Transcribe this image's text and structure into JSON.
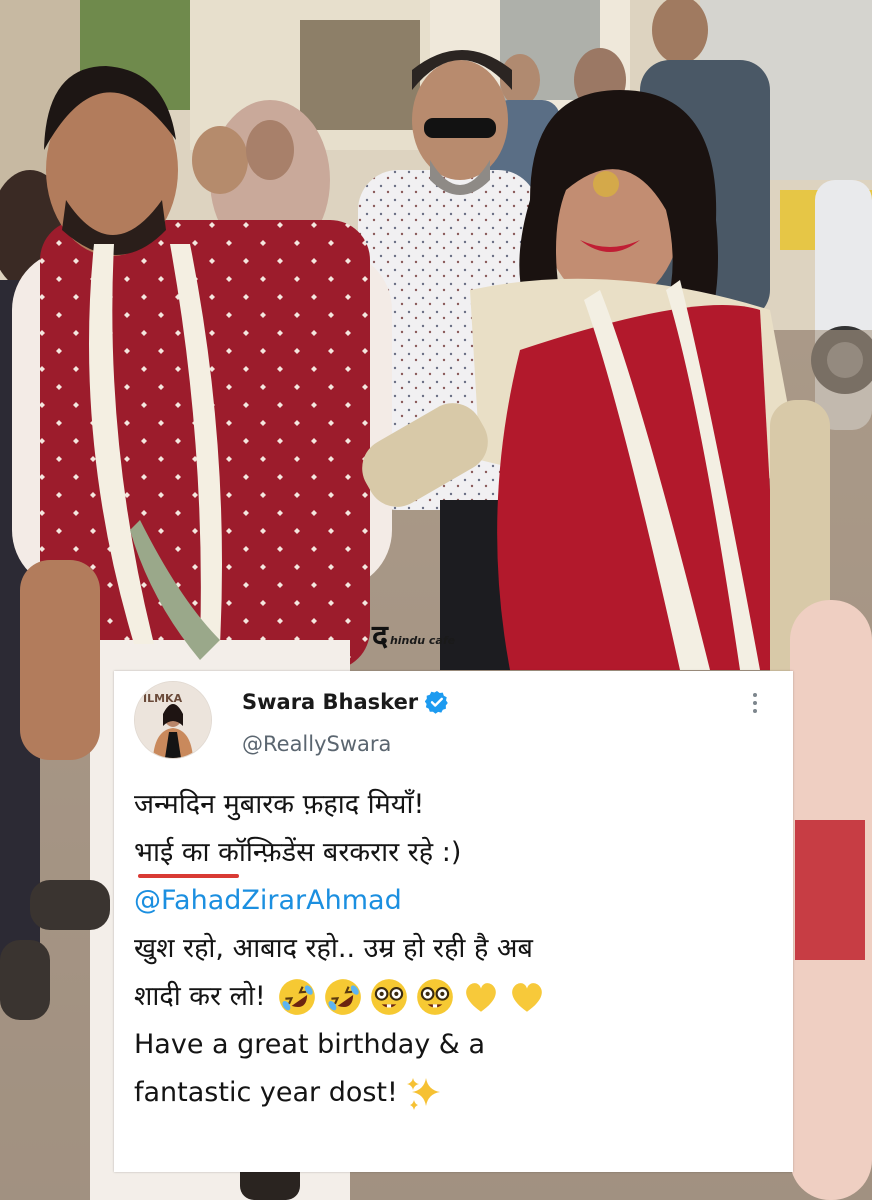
{
  "watermark": {
    "glyph": "द",
    "text": "hindu cafe"
  },
  "tweet": {
    "avatar_badge": "ILMKA",
    "display_name": "Swara Bhasker",
    "handle": "@ReallySwara",
    "lines": [
      "जन्मदिन मुबारक फ़हाद मियाँ!",
      "भाई का कॉन्फ़िडेंस बरकरार रहे :)",
      "@FahadZirarAhmad",
      "खुश रहो, आबाद रहो..  उम्र हो रही है अब",
      "शादी कर लो!",
      "Have a great birthday & a",
      "fantastic year dost!"
    ],
    "emojis": [
      "rolling-laughing-emoji",
      "rolling-laughing-emoji",
      "nerd-face-emoji",
      "nerd-face-emoji",
      "yellow-heart-emoji",
      "yellow-heart-emoji"
    ]
  },
  "colors": {
    "mention": "#1b8fe0",
    "underline": "#d93a34",
    "verified": "#1d9bf0",
    "saree_red": "#b2192c",
    "jacket_red": "#9c1c2c"
  }
}
